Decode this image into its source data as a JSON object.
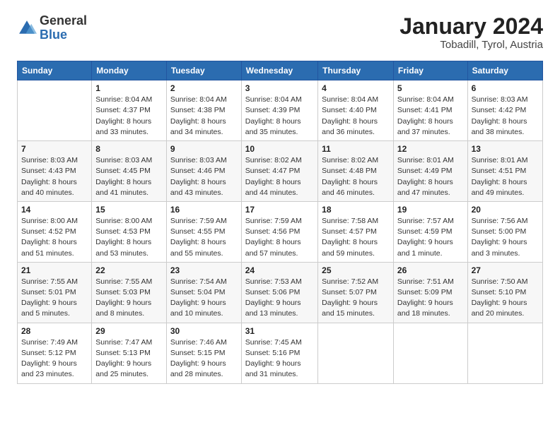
{
  "logo": {
    "general": "General",
    "blue": "Blue"
  },
  "header": {
    "month": "January 2024",
    "location": "Tobadill, Tyrol, Austria"
  },
  "weekdays": [
    "Sunday",
    "Monday",
    "Tuesday",
    "Wednesday",
    "Thursday",
    "Friday",
    "Saturday"
  ],
  "weeks": [
    [
      {
        "day": "",
        "info": ""
      },
      {
        "day": "1",
        "info": "Sunrise: 8:04 AM\nSunset: 4:37 PM\nDaylight: 8 hours\nand 33 minutes."
      },
      {
        "day": "2",
        "info": "Sunrise: 8:04 AM\nSunset: 4:38 PM\nDaylight: 8 hours\nand 34 minutes."
      },
      {
        "day": "3",
        "info": "Sunrise: 8:04 AM\nSunset: 4:39 PM\nDaylight: 8 hours\nand 35 minutes."
      },
      {
        "day": "4",
        "info": "Sunrise: 8:04 AM\nSunset: 4:40 PM\nDaylight: 8 hours\nand 36 minutes."
      },
      {
        "day": "5",
        "info": "Sunrise: 8:04 AM\nSunset: 4:41 PM\nDaylight: 8 hours\nand 37 minutes."
      },
      {
        "day": "6",
        "info": "Sunrise: 8:03 AM\nSunset: 4:42 PM\nDaylight: 8 hours\nand 38 minutes."
      }
    ],
    [
      {
        "day": "7",
        "info": "Sunrise: 8:03 AM\nSunset: 4:43 PM\nDaylight: 8 hours\nand 40 minutes."
      },
      {
        "day": "8",
        "info": "Sunrise: 8:03 AM\nSunset: 4:45 PM\nDaylight: 8 hours\nand 41 minutes."
      },
      {
        "day": "9",
        "info": "Sunrise: 8:03 AM\nSunset: 4:46 PM\nDaylight: 8 hours\nand 43 minutes."
      },
      {
        "day": "10",
        "info": "Sunrise: 8:02 AM\nSunset: 4:47 PM\nDaylight: 8 hours\nand 44 minutes."
      },
      {
        "day": "11",
        "info": "Sunrise: 8:02 AM\nSunset: 4:48 PM\nDaylight: 8 hours\nand 46 minutes."
      },
      {
        "day": "12",
        "info": "Sunrise: 8:01 AM\nSunset: 4:49 PM\nDaylight: 8 hours\nand 47 minutes."
      },
      {
        "day": "13",
        "info": "Sunrise: 8:01 AM\nSunset: 4:51 PM\nDaylight: 8 hours\nand 49 minutes."
      }
    ],
    [
      {
        "day": "14",
        "info": "Sunrise: 8:00 AM\nSunset: 4:52 PM\nDaylight: 8 hours\nand 51 minutes."
      },
      {
        "day": "15",
        "info": "Sunrise: 8:00 AM\nSunset: 4:53 PM\nDaylight: 8 hours\nand 53 minutes."
      },
      {
        "day": "16",
        "info": "Sunrise: 7:59 AM\nSunset: 4:55 PM\nDaylight: 8 hours\nand 55 minutes."
      },
      {
        "day": "17",
        "info": "Sunrise: 7:59 AM\nSunset: 4:56 PM\nDaylight: 8 hours\nand 57 minutes."
      },
      {
        "day": "18",
        "info": "Sunrise: 7:58 AM\nSunset: 4:57 PM\nDaylight: 8 hours\nand 59 minutes."
      },
      {
        "day": "19",
        "info": "Sunrise: 7:57 AM\nSunset: 4:59 PM\nDaylight: 9 hours\nand 1 minute."
      },
      {
        "day": "20",
        "info": "Sunrise: 7:56 AM\nSunset: 5:00 PM\nDaylight: 9 hours\nand 3 minutes."
      }
    ],
    [
      {
        "day": "21",
        "info": "Sunrise: 7:55 AM\nSunset: 5:01 PM\nDaylight: 9 hours\nand 5 minutes."
      },
      {
        "day": "22",
        "info": "Sunrise: 7:55 AM\nSunset: 5:03 PM\nDaylight: 9 hours\nand 8 minutes."
      },
      {
        "day": "23",
        "info": "Sunrise: 7:54 AM\nSunset: 5:04 PM\nDaylight: 9 hours\nand 10 minutes."
      },
      {
        "day": "24",
        "info": "Sunrise: 7:53 AM\nSunset: 5:06 PM\nDaylight: 9 hours\nand 13 minutes."
      },
      {
        "day": "25",
        "info": "Sunrise: 7:52 AM\nSunset: 5:07 PM\nDaylight: 9 hours\nand 15 minutes."
      },
      {
        "day": "26",
        "info": "Sunrise: 7:51 AM\nSunset: 5:09 PM\nDaylight: 9 hours\nand 18 minutes."
      },
      {
        "day": "27",
        "info": "Sunrise: 7:50 AM\nSunset: 5:10 PM\nDaylight: 9 hours\nand 20 minutes."
      }
    ],
    [
      {
        "day": "28",
        "info": "Sunrise: 7:49 AM\nSunset: 5:12 PM\nDaylight: 9 hours\nand 23 minutes."
      },
      {
        "day": "29",
        "info": "Sunrise: 7:47 AM\nSunset: 5:13 PM\nDaylight: 9 hours\nand 25 minutes."
      },
      {
        "day": "30",
        "info": "Sunrise: 7:46 AM\nSunset: 5:15 PM\nDaylight: 9 hours\nand 28 minutes."
      },
      {
        "day": "31",
        "info": "Sunrise: 7:45 AM\nSunset: 5:16 PM\nDaylight: 9 hours\nand 31 minutes."
      },
      {
        "day": "",
        "info": ""
      },
      {
        "day": "",
        "info": ""
      },
      {
        "day": "",
        "info": ""
      }
    ]
  ]
}
